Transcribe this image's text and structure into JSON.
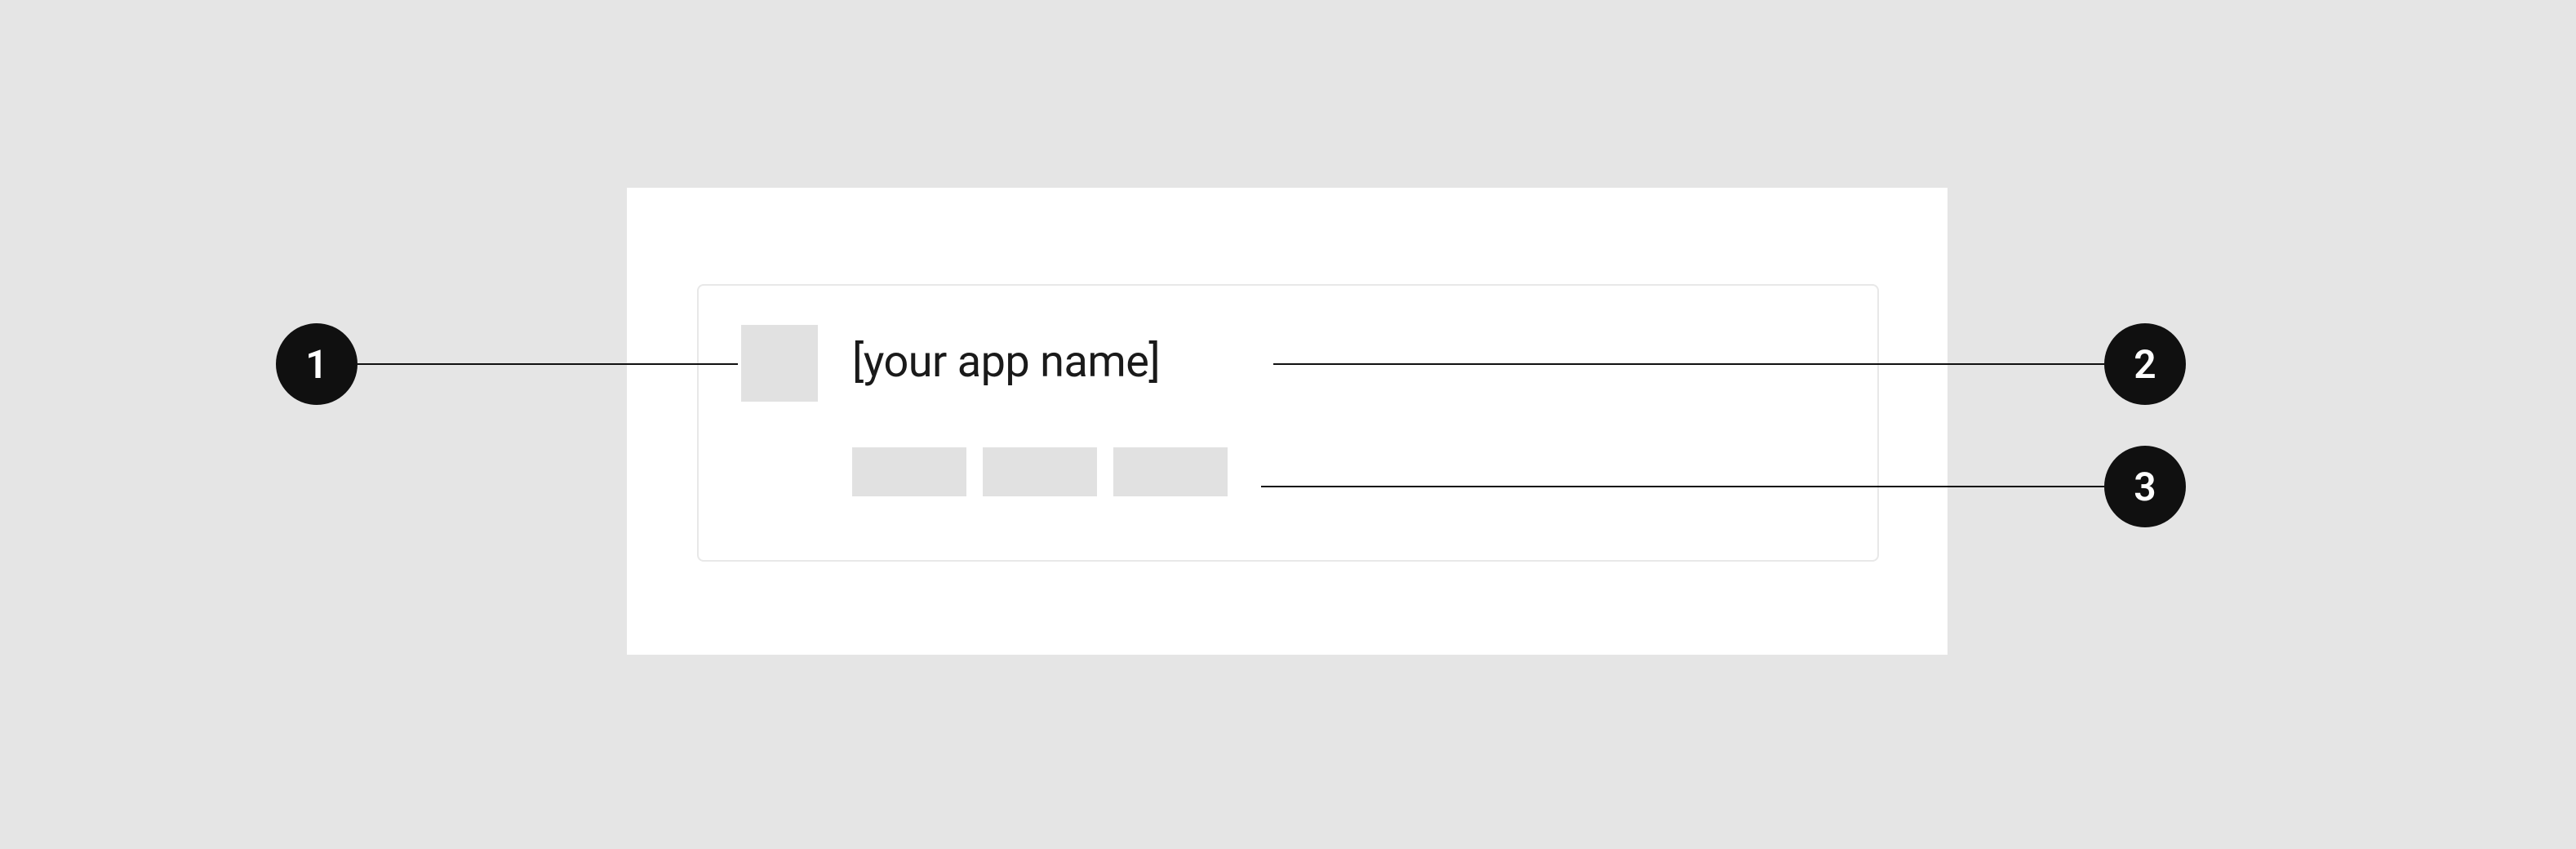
{
  "callouts": {
    "one": "1",
    "two": "2",
    "three": "3"
  },
  "card": {
    "app_name": "[your app name]"
  }
}
